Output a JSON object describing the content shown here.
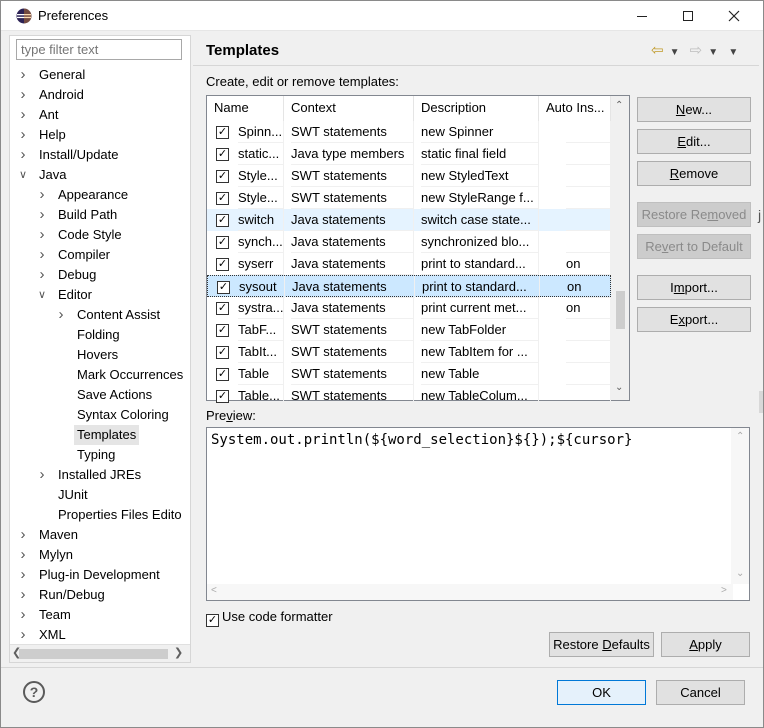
{
  "window": {
    "title": "Preferences",
    "app_icon": "eclipse-icon",
    "controls": [
      "minimize-icon",
      "maximize-icon",
      "close-icon"
    ]
  },
  "filter": {
    "placeholder": "type filter text"
  },
  "tree": [
    {
      "label": "General",
      "arrow": "collapsed"
    },
    {
      "label": "Android",
      "arrow": "collapsed"
    },
    {
      "label": "Ant",
      "arrow": "collapsed"
    },
    {
      "label": "Help",
      "arrow": "collapsed"
    },
    {
      "label": "Install/Update",
      "arrow": "collapsed"
    },
    {
      "label": "Java",
      "arrow": "expanded"
    },
    {
      "label": "Appearance",
      "arrow": "collapsed"
    },
    {
      "label": "Build Path",
      "arrow": "collapsed"
    },
    {
      "label": "Code Style",
      "arrow": "collapsed"
    },
    {
      "label": "Compiler",
      "arrow": "collapsed"
    },
    {
      "label": "Debug",
      "arrow": "collapsed"
    },
    {
      "label": "Editor",
      "arrow": "expanded"
    },
    {
      "label": "Content Assist",
      "arrow": "collapsed"
    },
    {
      "label": "Folding",
      "arrow": "none"
    },
    {
      "label": "Hovers",
      "arrow": "none"
    },
    {
      "label": "Mark Occurrences",
      "arrow": "none"
    },
    {
      "label": "Save Actions",
      "arrow": "none"
    },
    {
      "label": "Syntax Coloring",
      "arrow": "none"
    },
    {
      "label": "Templates",
      "arrow": "none",
      "selected": true
    },
    {
      "label": "Typing",
      "arrow": "none"
    },
    {
      "label": "Installed JREs",
      "arrow": "collapsed"
    },
    {
      "label": "JUnit",
      "arrow": "none"
    },
    {
      "label": "Properties Files Edito",
      "arrow": "none"
    },
    {
      "label": "Maven",
      "arrow": "collapsed"
    },
    {
      "label": "Mylyn",
      "arrow": "collapsed"
    },
    {
      "label": "Plug-in Development",
      "arrow": "collapsed"
    },
    {
      "label": "Run/Debug",
      "arrow": "collapsed"
    },
    {
      "label": "Team",
      "arrow": "collapsed"
    },
    {
      "label": "XML",
      "arrow": "collapsed"
    }
  ],
  "page": {
    "title": "Templates",
    "description": "Create, edit or remove templates:",
    "nav_icons": [
      "back-arrow-icon",
      "back-dropdown-icon",
      "forward-arrow-icon",
      "forward-dropdown-icon",
      "view-menu-icon"
    ]
  },
  "table": {
    "columns": [
      "Name",
      "Context",
      "Description",
      "Auto Ins..."
    ],
    "rows": [
      {
        "checked": true,
        "name": "Spinn...",
        "context": "SWT statements",
        "description": "new Spinner",
        "auto": ""
      },
      {
        "checked": true,
        "name": "static...",
        "context": "Java type members",
        "description": "static final field",
        "auto": ""
      },
      {
        "checked": true,
        "name": "Style...",
        "context": "SWT statements",
        "description": "new StyledText",
        "auto": ""
      },
      {
        "checked": true,
        "name": "Style...",
        "context": "SWT statements",
        "description": "new StyleRange f...",
        "auto": ""
      },
      {
        "checked": true,
        "name": "switch",
        "context": "Java statements",
        "description": "switch case state...",
        "auto": "",
        "state": "hover"
      },
      {
        "checked": true,
        "name": "synch...",
        "context": "Java statements",
        "description": "synchronized blo...",
        "auto": ""
      },
      {
        "checked": true,
        "name": "syserr",
        "context": "Java statements",
        "description": "print to standard...",
        "auto": "on"
      },
      {
        "checked": true,
        "name": "sysout",
        "context": "Java statements",
        "description": "print to standard...",
        "auto": "on",
        "state": "selected"
      },
      {
        "checked": true,
        "name": "systra...",
        "context": "Java statements",
        "description": "print current met...",
        "auto": "on"
      },
      {
        "checked": true,
        "name": "TabF...",
        "context": "SWT statements",
        "description": "new TabFolder",
        "auto": ""
      },
      {
        "checked": true,
        "name": "TabIt...",
        "context": "SWT statements",
        "description": "new TabItem for ...",
        "auto": ""
      },
      {
        "checked": true,
        "name": "Table",
        "context": "SWT statements",
        "description": "new Table",
        "auto": ""
      },
      {
        "checked": true,
        "name": "Table...",
        "context": "SWT statements",
        "description": "new TableColum...",
        "auto": ""
      }
    ]
  },
  "buttons": {
    "new": "New...",
    "edit": "Edit...",
    "remove": "Remove",
    "restore_removed": "Restore Removed",
    "revert": "Revert to Default",
    "import": "Import...",
    "export": "Export...",
    "restore_defaults": "Restore Defaults",
    "apply": "Apply",
    "ok": "OK",
    "cancel": "Cancel"
  },
  "preview": {
    "label": "Preview:",
    "code": "System.out.println(${word_selection}${});${cursor}"
  },
  "options": {
    "use_code_formatter": "Use code formatter",
    "use_code_formatter_checked": true
  }
}
